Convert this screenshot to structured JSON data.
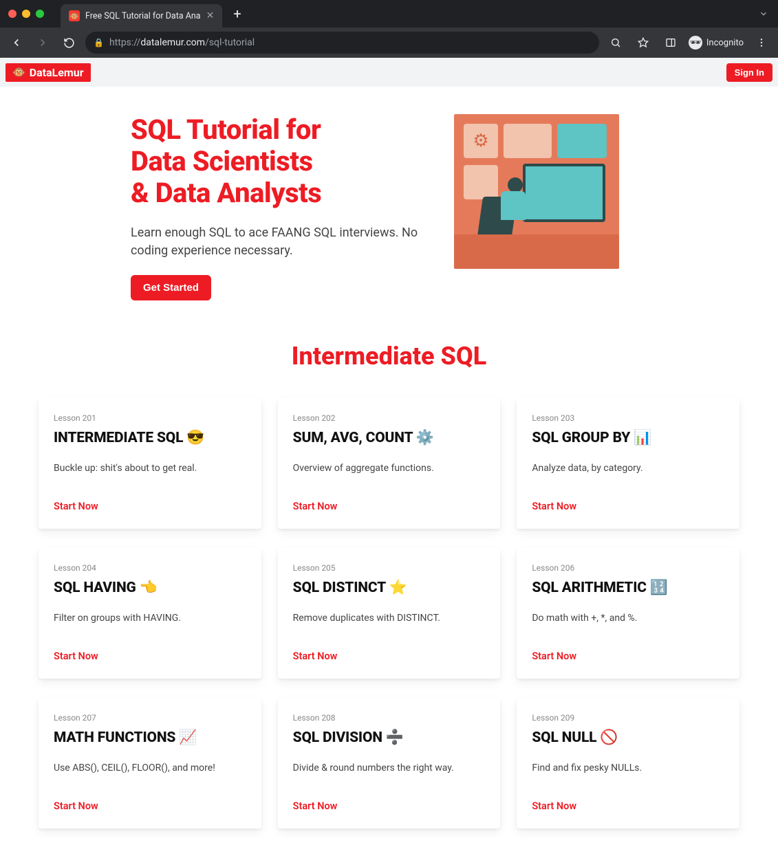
{
  "browser": {
    "tab_title": "Free SQL Tutorial for Data Ana",
    "url_scheme": "https://",
    "url_host": "datalemur.com",
    "url_path": "/sql-tutorial",
    "incognito_label": "Incognito"
  },
  "header": {
    "brand": "DataLemur",
    "signin": "Sign In"
  },
  "hero": {
    "title_l1": "SQL Tutorial for",
    "title_l2": "Data Scientists",
    "title_l3": "& Data Analysts",
    "subtitle": "Learn enough SQL to ace FAANG SQL interviews. No coding experience necessary.",
    "cta": "Get Started"
  },
  "section_title": "Intermediate SQL",
  "lessons": [
    {
      "tag": "Lesson 201",
      "title": "INTERMEDIATE SQL 😎",
      "desc": "Buckle up: shit's about to get real.",
      "action": "Start Now"
    },
    {
      "tag": "Lesson 202",
      "title": "SUM, AVG, COUNT ⚙️",
      "desc": "Overview of aggregate functions.",
      "action": "Start Now"
    },
    {
      "tag": "Lesson 203",
      "title": "SQL GROUP BY 📊",
      "desc": "Analyze data, by category.",
      "action": "Start Now"
    },
    {
      "tag": "Lesson 204",
      "title": "SQL HAVING 👈",
      "desc": "Filter on groups with HAVING.",
      "action": "Start Now"
    },
    {
      "tag": "Lesson 205",
      "title": "SQL DISTINCT ⭐",
      "desc": "Remove duplicates with DISTINCT.",
      "action": "Start Now"
    },
    {
      "tag": "Lesson 206",
      "title": "SQL ARITHMETIC 🔢",
      "desc": "Do math with +, *, and %.",
      "action": "Start Now"
    },
    {
      "tag": "Lesson 207",
      "title": "MATH FUNCTIONS 📈",
      "desc": "Use ABS(), CEIL(), FLOOR(), and more!",
      "action": "Start Now"
    },
    {
      "tag": "Lesson 208",
      "title": "SQL DIVISION ➗",
      "desc": "Divide & round numbers the right way.",
      "action": "Start Now"
    },
    {
      "tag": "Lesson 209",
      "title": "SQL NULL 🚫",
      "desc": "Find and fix pesky NULLs.",
      "action": "Start Now"
    }
  ]
}
